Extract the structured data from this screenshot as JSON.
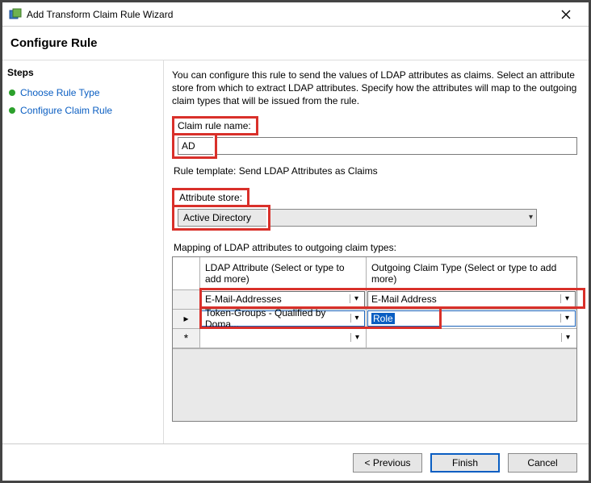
{
  "window": {
    "title": "Add Transform Claim Rule Wizard"
  },
  "page": {
    "heading": "Configure Rule"
  },
  "sidebar": {
    "title": "Steps",
    "items": [
      {
        "label": "Choose Rule Type"
      },
      {
        "label": "Configure Claim Rule"
      }
    ]
  },
  "content": {
    "description": "You can configure this rule to send the values of LDAP attributes as claims. Select an attribute store from which to extract LDAP attributes. Specify how the attributes will map to the outgoing claim types that will be issued from the rule.",
    "claim_rule_name_label": "Claim rule name:",
    "claim_rule_name_value": "AD",
    "rule_template": "Rule template: Send LDAP Attributes as Claims",
    "attribute_store_label": "Attribute store:",
    "attribute_store_value": "Active Directory",
    "mapping_label": "Mapping of LDAP attributes to outgoing claim types:",
    "grid": {
      "header_ldap": "LDAP Attribute (Select or type to add more)",
      "header_claim": "Outgoing Claim Type (Select or type to add more)",
      "rows": [
        {
          "ldap": "E-Mail-Addresses",
          "claim": "E-Mail Address"
        },
        {
          "ldap": "Token-Groups - Qualified by Doma...",
          "claim": "Role"
        },
        {
          "ldap": "",
          "claim": ""
        }
      ],
      "row_markers": [
        "",
        "▸",
        "*"
      ]
    }
  },
  "footer": {
    "previous": "< Previous",
    "finish": "Finish",
    "cancel": "Cancel"
  }
}
